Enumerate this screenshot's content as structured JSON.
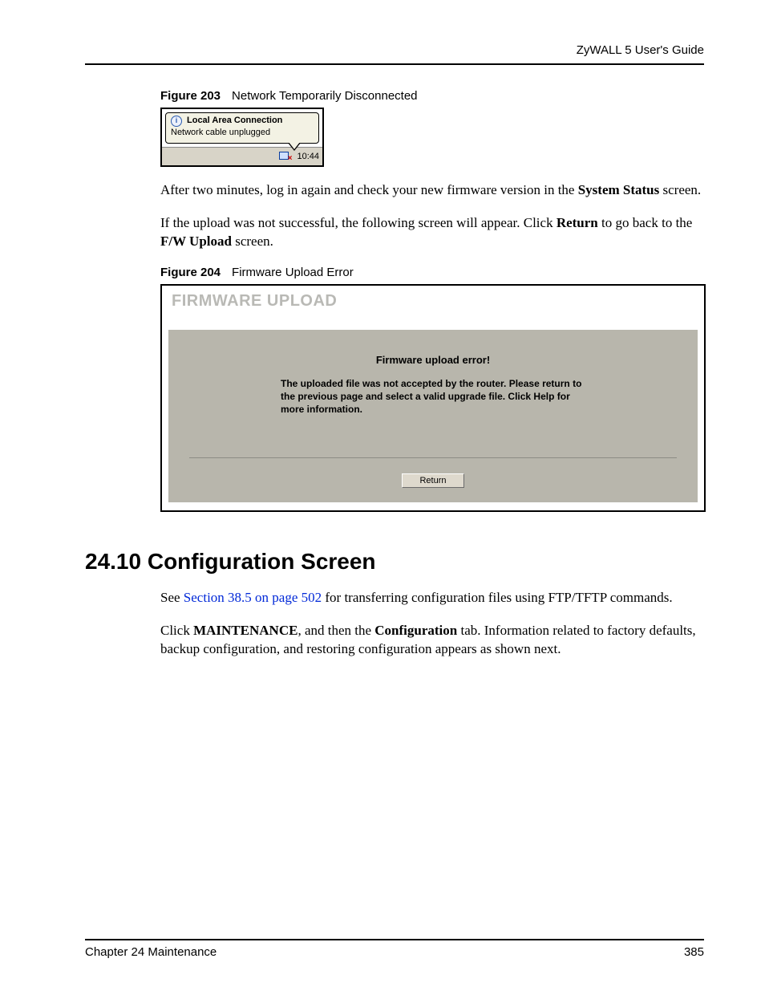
{
  "header": {
    "title": "ZyWALL 5 User's Guide"
  },
  "fig203": {
    "label_num": "Figure 203",
    "label_text": "Network Temporarily Disconnected",
    "balloon_title": "Local Area Connection",
    "balloon_body": "Network cable unplugged",
    "clock": "10:44"
  },
  "para_after_fig203_a": "After two minutes, log in again and check your new firmware version in the ",
  "para_after_fig203_b": "System Status",
  "para_after_fig203_c": " screen.",
  "para_upload_fail_a": "If the upload was not successful, the following screen will appear.  Click ",
  "para_upload_fail_b": "Return",
  "para_upload_fail_c": " to go back to the ",
  "para_upload_fail_d": "F/W Upload",
  "para_upload_fail_e": " screen.",
  "fig204": {
    "label_num": "Figure 204",
    "label_text": "Firmware Upload Error",
    "panel_heading": "FIRMWARE UPLOAD",
    "error_title": "Firmware upload error!",
    "error_msg": "The uploaded file was not accepted by the router. Please return to the previous page and select a valid upgrade file. Click Help for more information.",
    "return_btn": "Return"
  },
  "section": {
    "heading": "24.10  Configuration Screen",
    "see_a": "See ",
    "see_link": "Section 38.5 on page 502",
    "see_b": " for transferring configuration files using FTP/TFTP commands.",
    "click_a": "Click ",
    "click_b": "MAINTENANCE",
    "click_c": ", and then the ",
    "click_d": "Configuration",
    "click_e": " tab. Information related to factory defaults, backup configuration, and restoring configuration appears as shown next."
  },
  "footer": {
    "left": "Chapter 24 Maintenance",
    "right": "385"
  }
}
